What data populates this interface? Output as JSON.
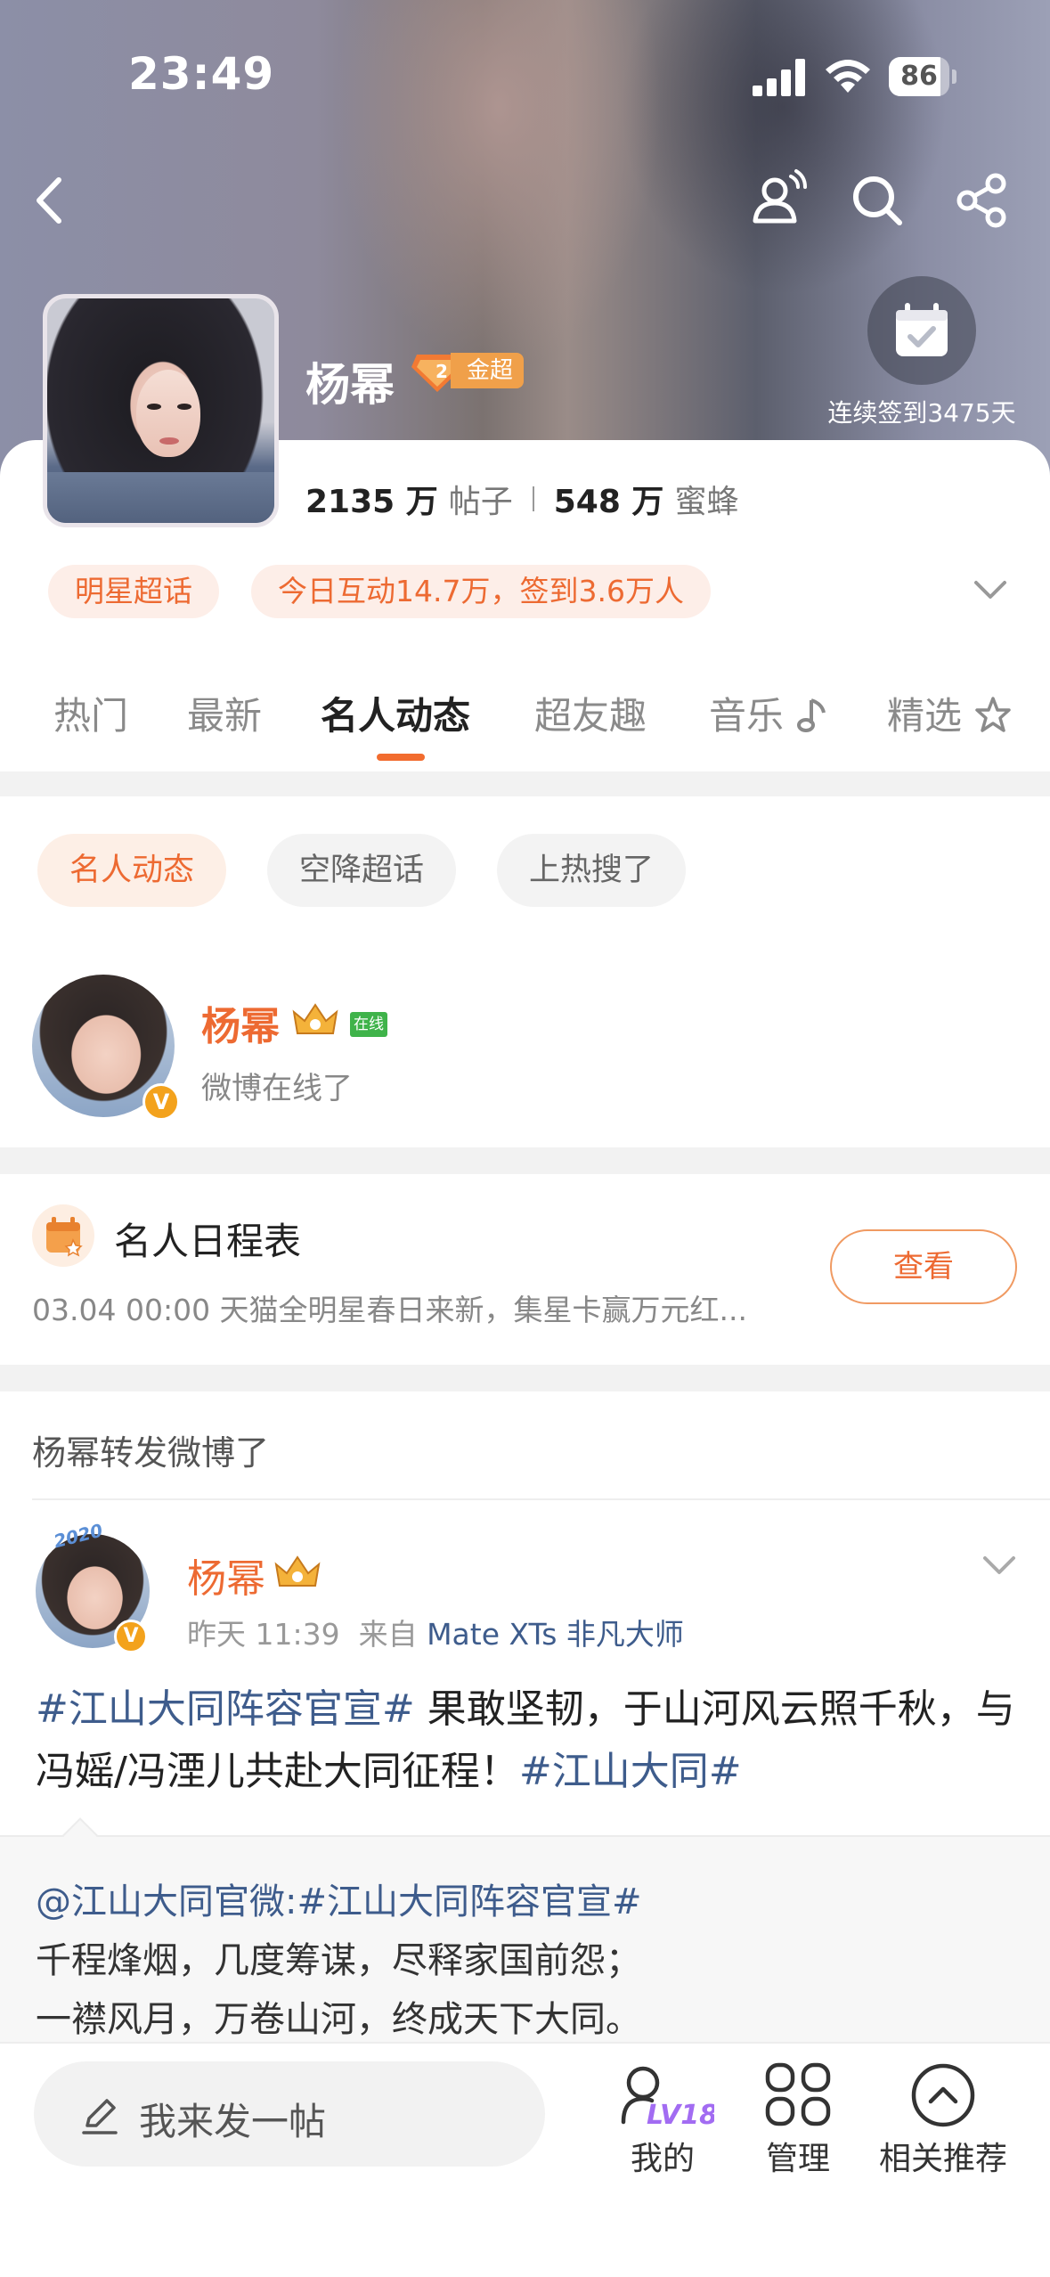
{
  "status_bar": {
    "time": "23:49",
    "battery": "86",
    "battery_level": 0.86
  },
  "header": {
    "name": "杨幂",
    "badge": "金超",
    "badge_level": "2",
    "checkin_text": "连续签到3475天"
  },
  "stats": {
    "posts_count": "2135 万",
    "posts_label": "帖子",
    "fans_count": "548 万",
    "fans_label": "蜜蜂"
  },
  "tags": {
    "star": "明星超话",
    "today": "今日互动14.7万，签到3.6万人"
  },
  "tabs": [
    {
      "label": "热门"
    },
    {
      "label": "最新"
    },
    {
      "label": "名人动态"
    },
    {
      "label": "超友趣"
    },
    {
      "label": "音乐"
    },
    {
      "label": "精选"
    }
  ],
  "chips": [
    "名人动态",
    "空降超话",
    "上热搜了"
  ],
  "online_card": {
    "name": "杨幂",
    "online_tag": "在线",
    "text": "微博在线了",
    "verified": "V"
  },
  "schedule": {
    "title": "名人日程表",
    "line": "03.04 00:00 天猫全明星春日来新，集星卡赢万元红...",
    "button": "查看"
  },
  "repost_header": "杨幂转发微博了",
  "post": {
    "author": "杨幂",
    "time": "昨天 11:39",
    "from_label": "来自",
    "source": "Mate XTs 非凡大师",
    "avatar_frame_text": "2020",
    "text_hash1": "#江山大同阵容官宣#",
    "text_body": "果敢坚韧，于山河风云照千秋，与冯媱/冯湮儿共赴大同征程！",
    "text_hash2": "#江山大同#",
    "quote_line1_link": "@江山大同官微:#江山大同阵容官宣#",
    "quote_line2": "千程烽烟，几度筹谋，尽释家国前怨；",
    "quote_line3": "一襟风月，万卷山河，终成天下大同。"
  },
  "bottom_bar": {
    "compose_placeholder": "我来发一帖",
    "mine_label": "我的",
    "mine_level": "LV18",
    "manage_label": "管理",
    "related_label": "相关推荐"
  },
  "colors": {
    "accent": "#ed6a32",
    "link": "#3e5c8c",
    "badge": "#f0a04a",
    "online": "#3fb34a"
  }
}
